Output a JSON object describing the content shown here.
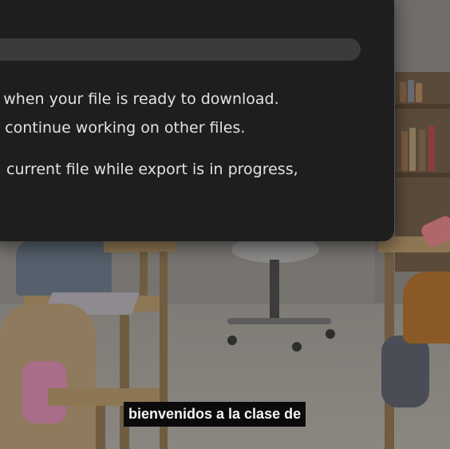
{
  "dialog": {
    "progress": 0.0,
    "lines": [
      "ail when your file is ready to download.",
      "nd continue working on other files.",
      " current file while export is in progress,"
    ]
  },
  "video": {
    "subtitle": "bienvenidos a la clase de"
  },
  "colors": {
    "dialog_bg": "#1e1e1e",
    "progress_track": "#3b3b3b",
    "subtitle_bg": "#0b0b0b",
    "text": "#e2e2e2"
  }
}
